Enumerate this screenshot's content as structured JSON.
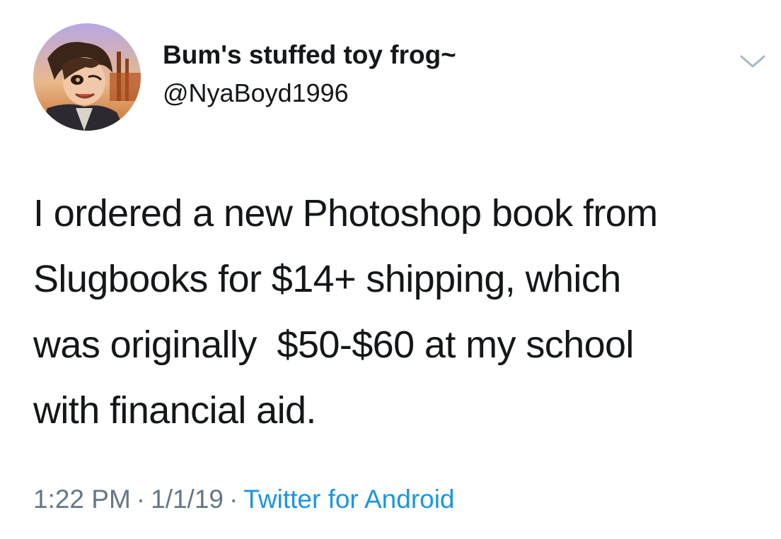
{
  "tweet": {
    "author": {
      "display_name": "Bum's stuffed toy frog~",
      "handle": "@NyaBoyd1996",
      "avatar_icon": "avatar-anime-character-portrait"
    },
    "menu_icon": "chevron-down-icon",
    "text_lines": [
      "I ordered a new Photoshop book from",
      "Slugbooks for $14+ shipping, which",
      "was originally  $50-$60 at my school",
      "with financial aid."
    ],
    "meta": {
      "time": "1:22 PM",
      "separator": "·",
      "date": "1/1/19",
      "source": "Twitter for Android"
    }
  },
  "colors": {
    "text": "#14171a",
    "secondary": "#657786",
    "link": "#1b95e0",
    "chevron": "#aab8c2"
  }
}
